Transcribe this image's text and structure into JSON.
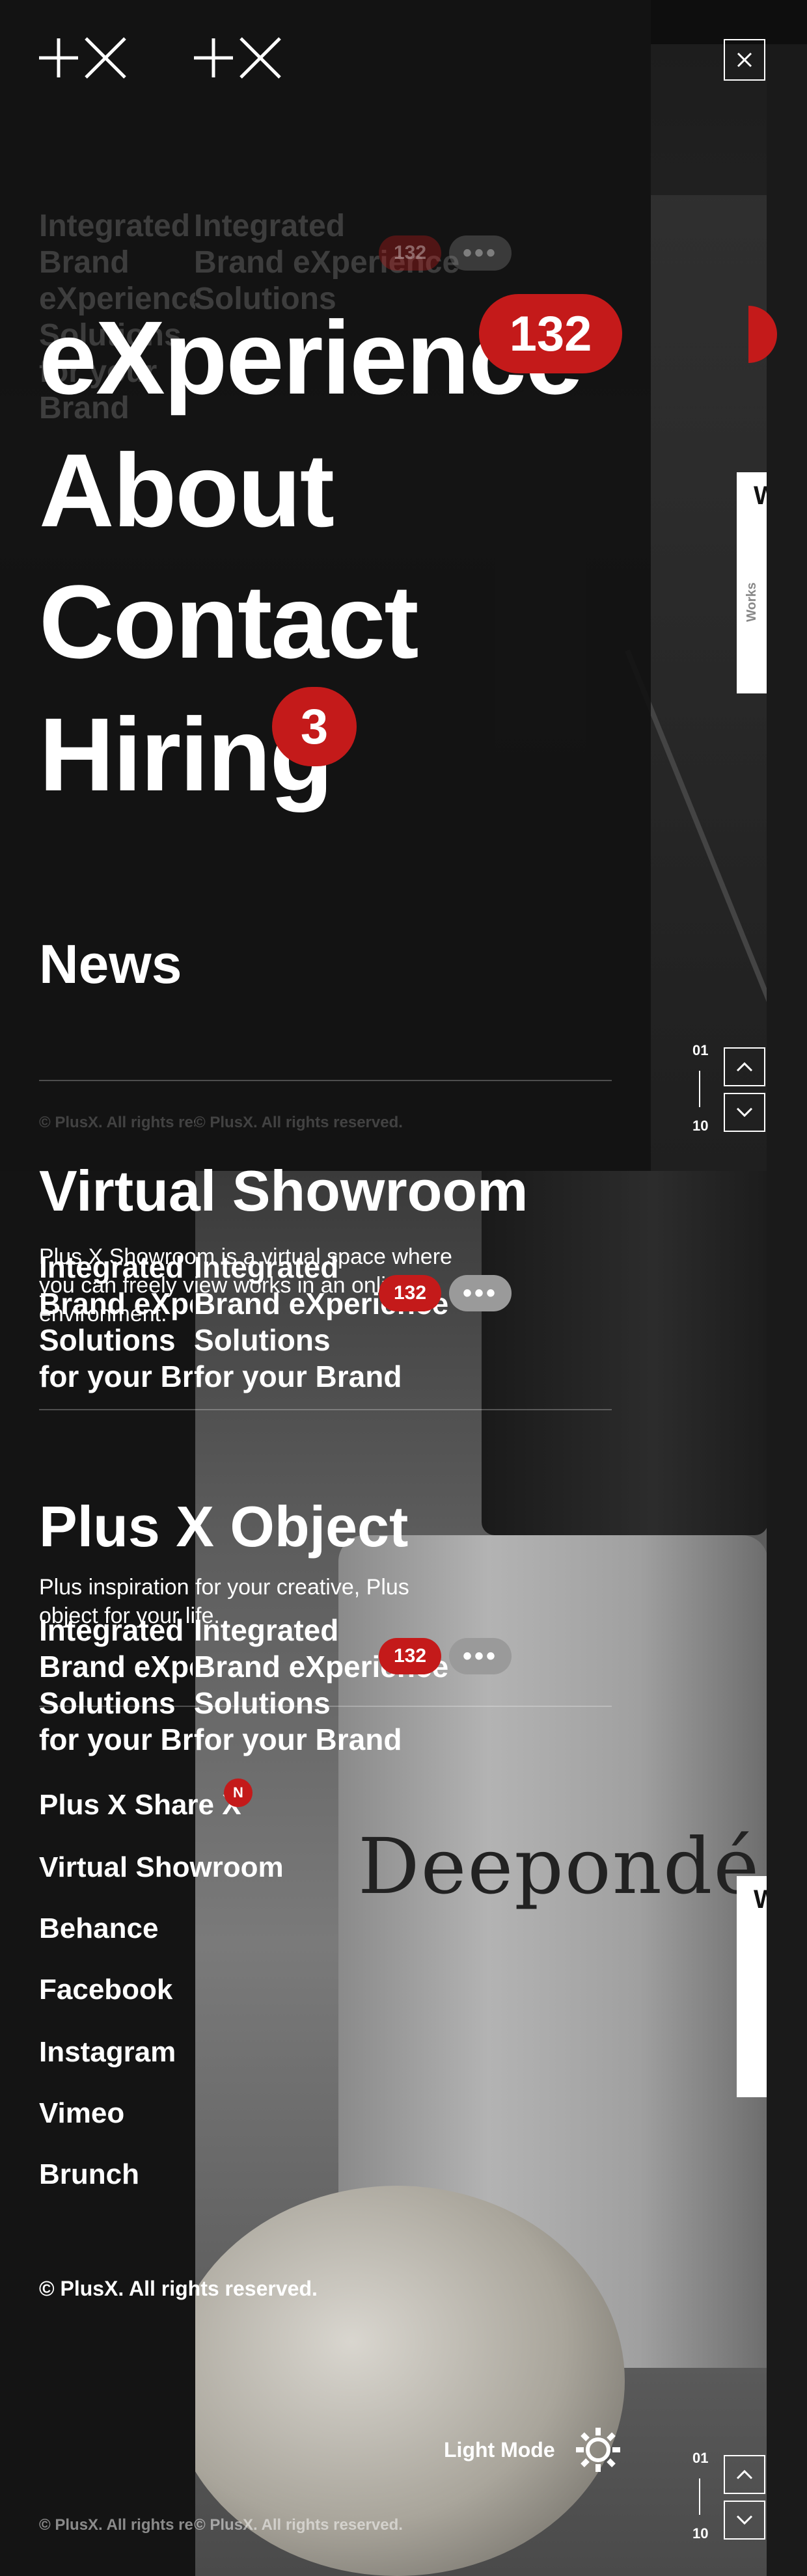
{
  "menu": {
    "items": [
      {
        "label": "eXperience",
        "badge": "132"
      },
      {
        "label": "About"
      },
      {
        "label": "Contact"
      },
      {
        "label": "Hiring",
        "badge": "3"
      },
      {
        "label": "News"
      }
    ],
    "close_icon": "close-icon"
  },
  "ghost_block": {
    "lines": [
      "Integrated",
      "Brand eXperience",
      "Solutions",
      "for your Brand"
    ],
    "badge": "132",
    "more": "•••"
  },
  "copyright": "© PlusX. All rights reserved.",
  "copyright_short": "© PlusX. All rights res",
  "pager": {
    "current": "01",
    "total": "10"
  },
  "showroom": {
    "title": "Virtual Showroom",
    "description": "Plus X Showroom is a virtual space where you can freely view works in an online environment."
  },
  "overlap_block": {
    "lines": [
      "Integrated",
      "Brand eXperience",
      "Solutions",
      "for your Brand"
    ],
    "lines_clipped": [
      "Integrated",
      "Brand eXpe",
      "Solutions",
      "for your Br"
    ],
    "badge": "132",
    "more": "•••"
  },
  "object": {
    "title": "Plus X Object",
    "description": "Plus inspiration for your creative, Plus object for your life."
  },
  "footer_links": [
    {
      "label": "Plus X Share X",
      "badge": "N"
    },
    {
      "label": "Virtual Showroom"
    },
    {
      "label": "Behance"
    },
    {
      "label": "Facebook"
    },
    {
      "label": "Instagram"
    },
    {
      "label": "Vimeo"
    },
    {
      "label": "Brunch"
    }
  ],
  "footer_copyright": "© PlusX. All rights reserved.",
  "light_mode": {
    "label": "Light Mode",
    "icon": "sun-icon"
  },
  "side_tabs": [
    {
      "label": "W.",
      "sub": "Works"
    },
    {
      "label": "W."
    }
  ],
  "product_brand": "Deepondé",
  "colors": {
    "accent": "#c41a1a",
    "background": "#161616",
    "text": "#ffffff"
  }
}
